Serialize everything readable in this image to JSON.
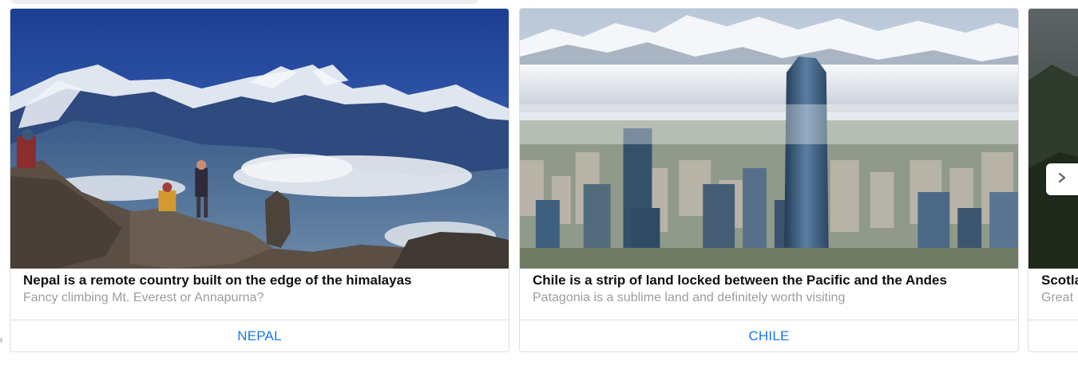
{
  "carousel": {
    "cards": [
      {
        "title": "Nepal is a remote country built on the edge of the himalayas",
        "subtitle": "Fancy climbing Mt. Everest or Annapurna?",
        "action_label": "NEPAL"
      },
      {
        "title": "Chile is a strip of land locked between the Pacific and the Andes",
        "subtitle": "Patagonia is a sublime land and definitely worth visiting",
        "action_label": "CHILE"
      },
      {
        "title": "Scotla",
        "subtitle": "Great"
      }
    ],
    "next_icon": "chevron-right-icon"
  },
  "colors": {
    "action": "#1877f2",
    "title": "#111111",
    "subtitle": "#9a9da1",
    "border": "#dddfe2"
  }
}
